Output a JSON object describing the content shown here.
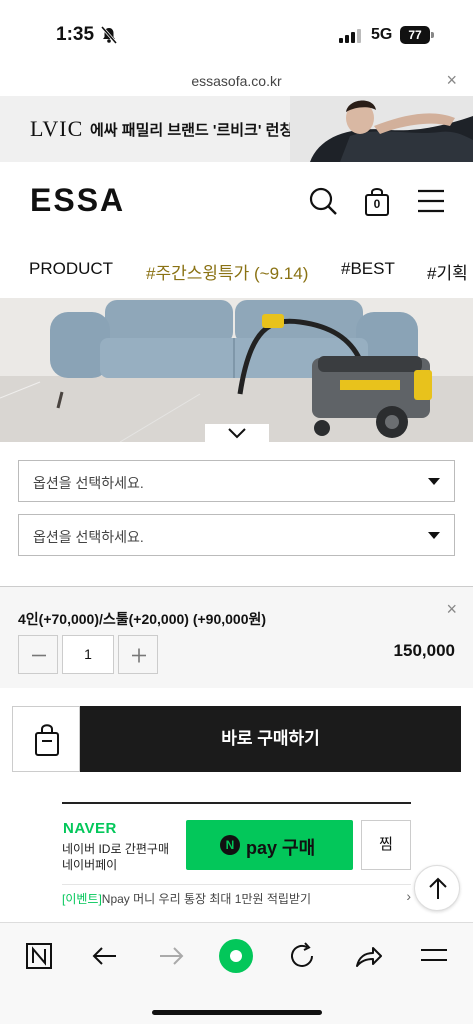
{
  "status_bar": {
    "time": "1:35",
    "network": "5G",
    "battery": "77"
  },
  "browser": {
    "url": "essasofa.co.kr",
    "close_label": "×"
  },
  "promo": {
    "brand": "LVIC",
    "text": "에싸 패밀리 브랜드 '르비크' 런칭"
  },
  "header": {
    "logo": "ESSA",
    "cart_count": "0"
  },
  "category_nav": {
    "items": [
      "PRODUCT",
      "#주간스윙특가 (~9.14)",
      "#BEST",
      "#기획"
    ],
    "highlight_color": "#8a7214"
  },
  "options": {
    "select1_placeholder": "옵션을 선택하세요.",
    "select2_placeholder": "옵션을 선택하세요."
  },
  "selected_item": {
    "label": "4인(+70,000)/스툴(+20,000) (+90,000원)",
    "quantity": "1",
    "price": "150,000",
    "close_label": "×"
  },
  "buy": {
    "buy_now_label": "바로 구매하기"
  },
  "naver_pay": {
    "logo": "NAVER",
    "sub1": "네이버 ID로 간편구매",
    "sub2": "네이버페이",
    "npay_letter": "N",
    "button_label": "pay 구매",
    "zzim_label": "찜",
    "event_tag": "[이벤트]",
    "event_text": "Npay 머니 우리 통장 최대 1만원 적립받기",
    "chevron": "›",
    "brand_color": "#03c75a"
  }
}
